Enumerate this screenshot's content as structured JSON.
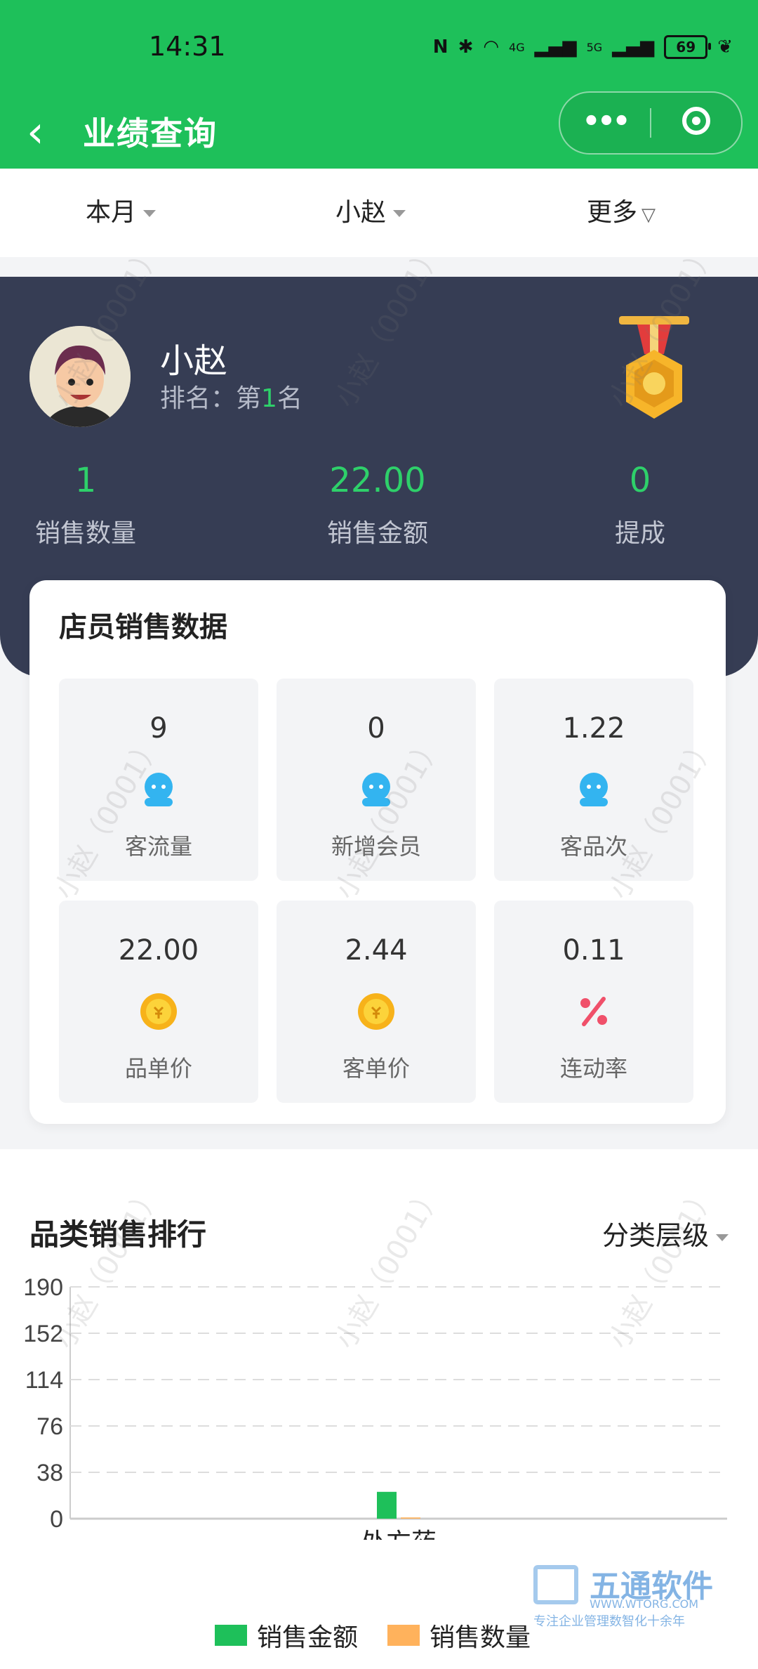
{
  "status": {
    "time": "14:31",
    "battery": "69",
    "signal_a": "4G",
    "signal_b": "5G"
  },
  "titlebar": {
    "title": "业绩查询"
  },
  "filters": {
    "period": "本月",
    "staff": "小赵",
    "more": "更多"
  },
  "profile": {
    "name": "小赵",
    "rank_prefix": "排名：",
    "rank_pre": "第",
    "rank_num": "1",
    "rank_post": "名",
    "stats": [
      {
        "value": "1",
        "label": "销售数量"
      },
      {
        "value": "22.00",
        "label": "销售金额"
      },
      {
        "value": "0",
        "label": "提成"
      }
    ]
  },
  "card": {
    "title": "店员销售数据",
    "tiles": [
      {
        "value": "9",
        "label": "客流量",
        "icon": "person-icon"
      },
      {
        "value": "0",
        "label": "新增会员",
        "icon": "person-icon"
      },
      {
        "value": "1.22",
        "label": "客品次",
        "icon": "person-icon"
      },
      {
        "value": "22.00",
        "label": "品单价",
        "icon": "coin-icon"
      },
      {
        "value": "2.44",
        "label": "客单价",
        "icon": "coin-icon"
      },
      {
        "value": "0.11",
        "label": "连动率",
        "icon": "percent-icon"
      }
    ]
  },
  "ranking": {
    "title": "品类销售排行",
    "filter": "分类层级"
  },
  "chart_data": {
    "type": "bar",
    "categories": [
      "处方药"
    ],
    "series": [
      {
        "name": "销售金额",
        "values": [
          22
        ],
        "color": "#1ec05a"
      },
      {
        "name": "销售数量",
        "values": [
          1
        ],
        "color": "#ffb25c"
      }
    ],
    "yticks": [
      "0",
      "38",
      "76",
      "114",
      "152",
      "190"
    ],
    "ylim": [
      0,
      190
    ],
    "grid": true,
    "legend": "bottom"
  },
  "watermark": "小赵（0001）",
  "brand": {
    "name": "五通软件",
    "url": "WWW.WTORG.COM",
    "slogan": "专注企业管理数智化十余年"
  },
  "colors": {
    "primary": "#1ec05a",
    "hero": "#363d54",
    "accent": "#2ed06a"
  }
}
